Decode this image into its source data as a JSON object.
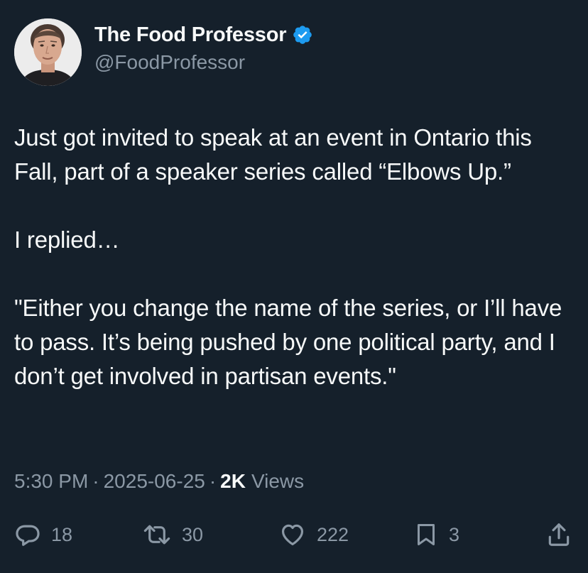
{
  "author": {
    "display_name": "The Food Professor",
    "handle": "@FoodProfessor",
    "verified": true,
    "verified_icon": "verified-badge-icon"
  },
  "tweet": {
    "text": "Just got invited to speak at an event in Ontario this Fall, part of a speaker series called “Elbows Up.”\n\nI replied…\n\n\"Either you change the name of the series, or I’ll have to pass. It’s being pushed by one political party, and I don’t get involved in partisan events.\""
  },
  "meta": {
    "time": "5:30 PM",
    "separator": "·",
    "date": "2025-06-25",
    "views_count": "2K",
    "views_label": "Views"
  },
  "actions": {
    "replies": "18",
    "retweets": "30",
    "likes": "222",
    "bookmarks": "3"
  },
  "colors": {
    "background": "#15202b",
    "text": "#f7f9f9",
    "secondary": "#8b98a5",
    "verified": "#1d9bf0"
  }
}
